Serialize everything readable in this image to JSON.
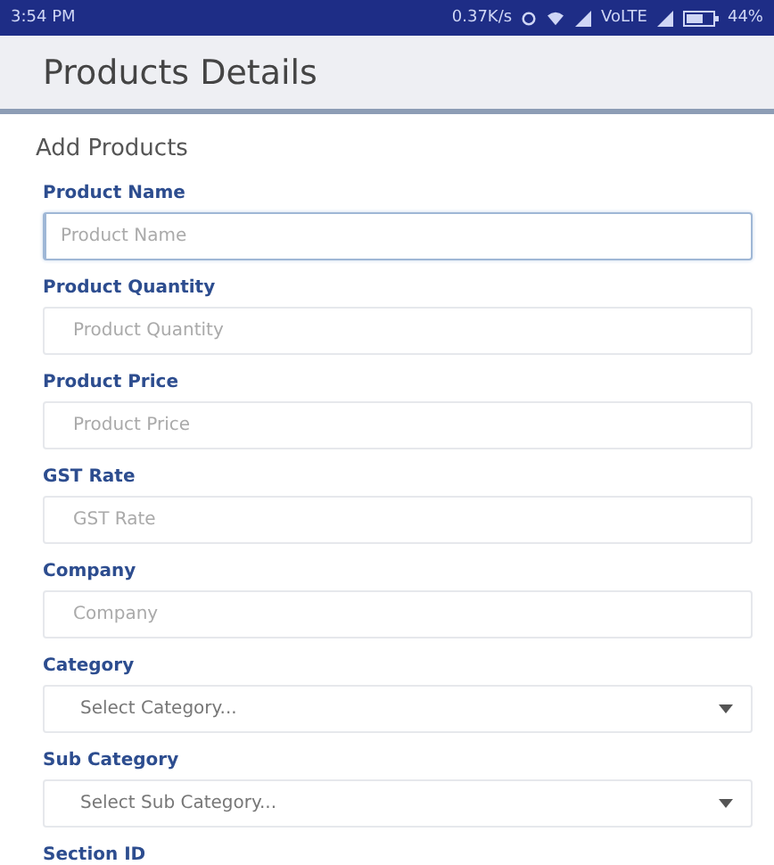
{
  "status_bar": {
    "time": "3:54 PM",
    "speed": "0.37K/s",
    "network": "VoLTE",
    "battery": "44%"
  },
  "app_bar": {
    "title": "Products Details"
  },
  "form": {
    "heading": "Add Products",
    "fields": [
      {
        "kind": "input",
        "label": "Product Name",
        "placeholder": "Product Name",
        "focused": true
      },
      {
        "kind": "input",
        "label": "Product Quantity",
        "placeholder": "Product Quantity",
        "focused": false
      },
      {
        "kind": "input",
        "label": "Product Price",
        "placeholder": "Product Price",
        "focused": false
      },
      {
        "kind": "input",
        "label": "GST Rate",
        "placeholder": "GST Rate",
        "focused": false
      },
      {
        "kind": "input",
        "label": "Company",
        "placeholder": "Company",
        "focused": false
      },
      {
        "kind": "select",
        "label": "Category",
        "placeholder": "Select Category...",
        "focused": false
      },
      {
        "kind": "select",
        "label": "Sub Category",
        "placeholder": "Select Sub Category...",
        "focused": false
      },
      {
        "kind": "label",
        "label": "Section ID"
      }
    ]
  }
}
